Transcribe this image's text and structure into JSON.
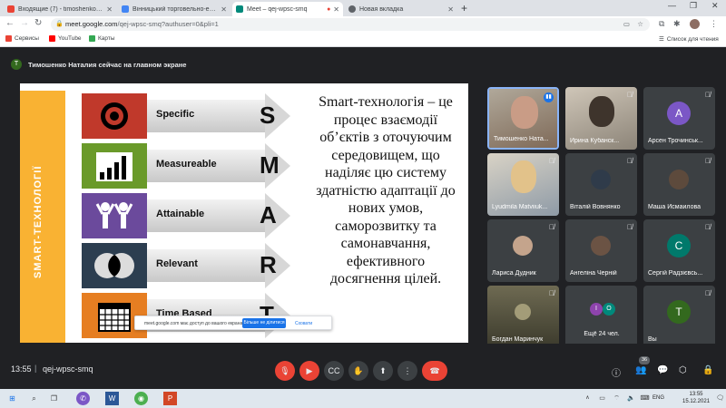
{
  "browser": {
    "tabs": [
      {
        "label": "Входящие (7) - timoshenko.natal...",
        "color": "#ea4335",
        "active": false
      },
      {
        "label": "Вінницький торговельно-еконо...",
        "color": "#4285f4",
        "active": false
      },
      {
        "label": "Meet – qej-wpsc-smq",
        "color": "#00897b",
        "active": true
      },
      {
        "label": "Новая вкладка",
        "color": "#5f6368",
        "active": false
      }
    ],
    "url_host": "meet.google.com",
    "url_path": "/qej-wpsc-smq?authuser=0&pli=1",
    "bookmarks": [
      {
        "label": "Сервисы",
        "color": "#ea4335"
      },
      {
        "label": "YouTube",
        "color": "#ff0000"
      },
      {
        "label": "Карты",
        "color": "#34a853"
      }
    ],
    "reading_list": "Список для чтения"
  },
  "meet": {
    "presenter_banner": "Тимошенко Наталия сейчас на главном экране",
    "presenter_initial": "Т",
    "slide": {
      "sidebar_title": "SMART-ТЕХНОЛОГІЇ",
      "rows": [
        {
          "label": "Specific",
          "letter": "S",
          "tile_color": "#c0392b"
        },
        {
          "label": "Measureable",
          "letter": "M",
          "tile_color": "#6a9a2a"
        },
        {
          "label": "Attainable",
          "letter": "A",
          "tile_color": "#6b4a9c"
        },
        {
          "label": "Relevant",
          "letter": "R",
          "tile_color": "#34495e"
        },
        {
          "label": "Time Based",
          "letter": "T",
          "tile_color": "#e67e22"
        }
      ],
      "text": "Smart-технологія – це процес взаємодії об’єктів з оточуючим середовищем, що наділяє цю систему здатністю адаптації до нових умов, саморозвитку та самонавчання, ефективного досягнення цілей."
    },
    "share_notice": {
      "text": "meet.google.com має доступ до вашого екрана.",
      "stop_button": "Більше не ділитися",
      "hide_link": "Сховати"
    },
    "participants": [
      {
        "name": "Тимошенко Ната...",
        "type": "video",
        "speaking": true
      },
      {
        "name": "Ирина Кубанск...",
        "type": "video",
        "speaking": false
      },
      {
        "name": "Арсен Трочинськ...",
        "type": "avatar",
        "initial": "А",
        "color": "#7b57c6"
      },
      {
        "name": "Lyudmila Matviiuk...",
        "type": "video",
        "speaking": false
      },
      {
        "name": "Віталій Вовнянко",
        "type": "photo"
      },
      {
        "name": "Маша Исмаилова",
        "type": "photo"
      },
      {
        "name": "Лариса Дудник",
        "type": "photo"
      },
      {
        "name": "Ангеліна Черній",
        "type": "photo"
      },
      {
        "name": "Сергій Радзієвсь...",
        "type": "avatar",
        "initial": "С",
        "color": "#00796b"
      },
      {
        "name": "Богдан Маринчук",
        "type": "video",
        "speaking": false
      },
      {
        "name": "Ещё 24 чел.",
        "type": "more",
        "initials": [
          "І",
          "О"
        ]
      },
      {
        "name": "Вы",
        "type": "avatar",
        "initial": "Т",
        "color": "#33691e"
      }
    ],
    "time": "13:55",
    "separator": "|",
    "code": "qej-wpsc-smq",
    "people_count": "36"
  },
  "taskbar": {
    "lang": "ENG",
    "time": "13:55",
    "date": "15.12.2021"
  }
}
